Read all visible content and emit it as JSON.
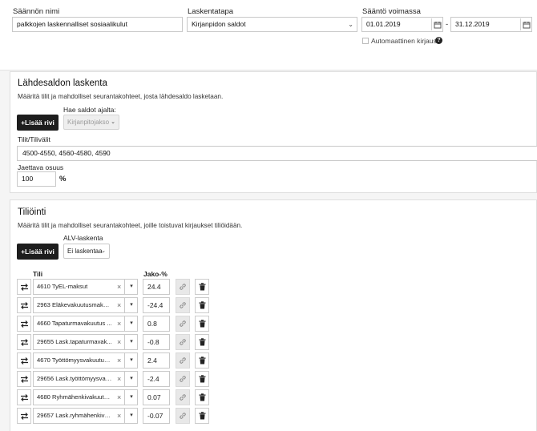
{
  "header": {
    "rule_name_label": "Säännön nimi",
    "rule_name_value": "palkkojen laskennalliset sosiaalikulut",
    "method_label": "Laskentatapa",
    "method_value": "Kirjanpidon saldot",
    "validity_label": "Sääntö voimassa",
    "start_date": "01.01.2019",
    "date_separator": "-",
    "end_date": "31.12.2019",
    "auto_post_label": "Automaattinen kirjaus",
    "auto_post_checked": false
  },
  "source": {
    "title": "Lähdesaldon laskenta",
    "description": "Määritä tilit ja mahdolliset seurantakohteet, josta lähdesaldo lasketaan.",
    "add_row_label": "+Lisää rivi",
    "fetch_label": "Hae saldot ajalta:",
    "fetch_value": "Kirjanpitojakso",
    "accounts_label": "Tilit/Tilivälit",
    "accounts_value": "4500-4550, 4560-4580, 4590",
    "share_label": "Jaettava osuus",
    "share_value": "100",
    "share_unit": "%"
  },
  "posting": {
    "title": "Tiliöinti",
    "description": "Määritä tilit ja mahdolliset seurantakohteet, joille toistuvat kirjaukset tiliöidään.",
    "add_row_label": "+Lisää rivi",
    "vat_label": "ALV-laskenta",
    "vat_value": "Ei laskentaa",
    "col_account": "Tili",
    "col_pct": "Jako-%",
    "rows": [
      {
        "account": "4610 TyEL-maksut",
        "pct": "24.4"
      },
      {
        "account": "2963 Eläkevakuutusmaksu ...",
        "pct": "-24.4"
      },
      {
        "account": "4660 Tapaturmavakuutus ...",
        "pct": "0.8"
      },
      {
        "account": "29655 Lask.tapaturmavak...",
        "pct": "-0.8"
      },
      {
        "account": "4670 Työttömyysvakuutus ...",
        "pct": "2.4"
      },
      {
        "account": "29656 Lask.työttömyysvak...",
        "pct": "-2.4"
      },
      {
        "account": "4680 Ryhmähenkivakuutus...",
        "pct": "0.07"
      },
      {
        "account": "29657 Lask.ryhmähenkiva...",
        "pct": "-0.07"
      }
    ]
  }
}
